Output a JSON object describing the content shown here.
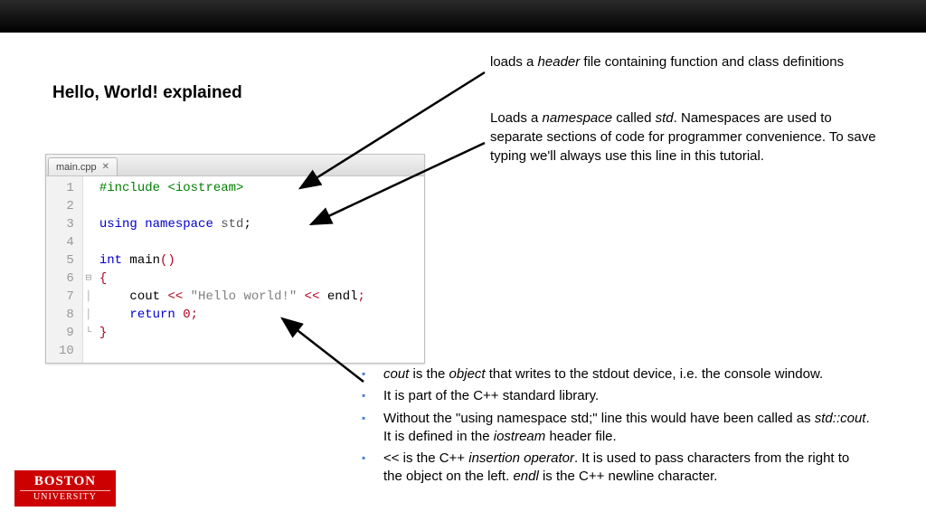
{
  "title": "Hello, World! explained",
  "annotations": {
    "header": "loads a <em>header</em> file containing function and class definitions",
    "namespace": "Loads a <em>namespace</em> called <em>std</em>. Namespaces are used to separate sections of code for programmer convenience. To save typing we'll always use this line in this tutorial."
  },
  "editor": {
    "tab_name": "main.cpp",
    "line_count": 10,
    "code": {
      "l1_pre": "#include ",
      "l1_lib": "<iostream>",
      "l3_a": "using ",
      "l3_b": "namespace ",
      "l3_c": "std",
      "l3_d": ";",
      "l5_a": "int ",
      "l5_b": "main",
      "l5_c": "()",
      "l6": "{",
      "l7_a": "    cout ",
      "l7_b": "<< ",
      "l7_c": "\"Hello world!\"",
      "l7_d": " << ",
      "l7_e": "endl",
      "l7_f": ";",
      "l8_a": "    return ",
      "l8_b": "0",
      "l8_c": ";",
      "l9": "}"
    }
  },
  "bullets": {
    "b1": "<em>cout</em> is the <em>object</em> that writes to the stdout device, i.e. the console window.",
    "b2": "It is part of the C++ standard library.",
    "b3": "Without the \"using namespace std;\" line this would have been called as <em>std::cout</em>. It is defined in the <em>iostream</em> header file.",
    "b4": "<< is the C++ <em>insertion operator</em>.  It is used to pass characters from the right to the object on the left.  <em>endl</em> is the C++ newline character."
  },
  "logo": {
    "line1": "BOSTON",
    "line2": "UNIVERSITY"
  }
}
